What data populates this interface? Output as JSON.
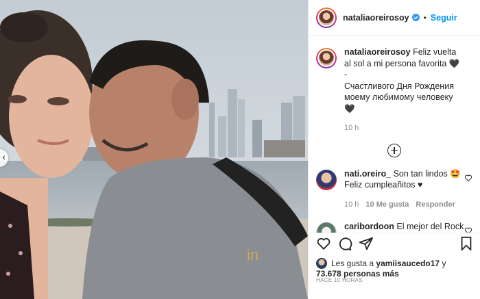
{
  "account": {
    "username": "nataliaoreirosoy",
    "follow_label": "Seguir",
    "separator": "•"
  },
  "caption": {
    "username": "nataliaoreirosoy",
    "line1": "Feliz vuelta al sol a mi persona favorita 🖤",
    "line2": "-",
    "line3": "Счастливого Дня Рождения моему любимому человеку 🖤",
    "time": "10 h"
  },
  "comments": [
    {
      "username": "nati.oreiro_",
      "text": "Son tan lindos 🤩 Feliz cumpleañitos ♥",
      "time": "10 h",
      "likes": "10 Me gusta",
      "reply": "Responder"
    },
    {
      "username": "caribordoon",
      "text": "El mejor del Rock Nacional!!!!!! FELIZ CUMPLE MOLLO QUERIDO!!!!!!!!!!!!❤️❤️"
    }
  ],
  "likes": {
    "prefix": "Les gusta a",
    "liker": "yamiisaucedo17",
    "connector": "y",
    "count": "73.678 personas más"
  },
  "timestamp": "HACE 10 HORAS",
  "icons": [
    "verified-badge-icon",
    "heart-icon",
    "comment-icon",
    "share-icon",
    "bookmark-icon",
    "add-comment-icon",
    "carousel-left-icon"
  ],
  "colors": {
    "accent": "#0095f6",
    "text": "#262626",
    "muted": "#8e8e8e",
    "border": "#efefef"
  }
}
